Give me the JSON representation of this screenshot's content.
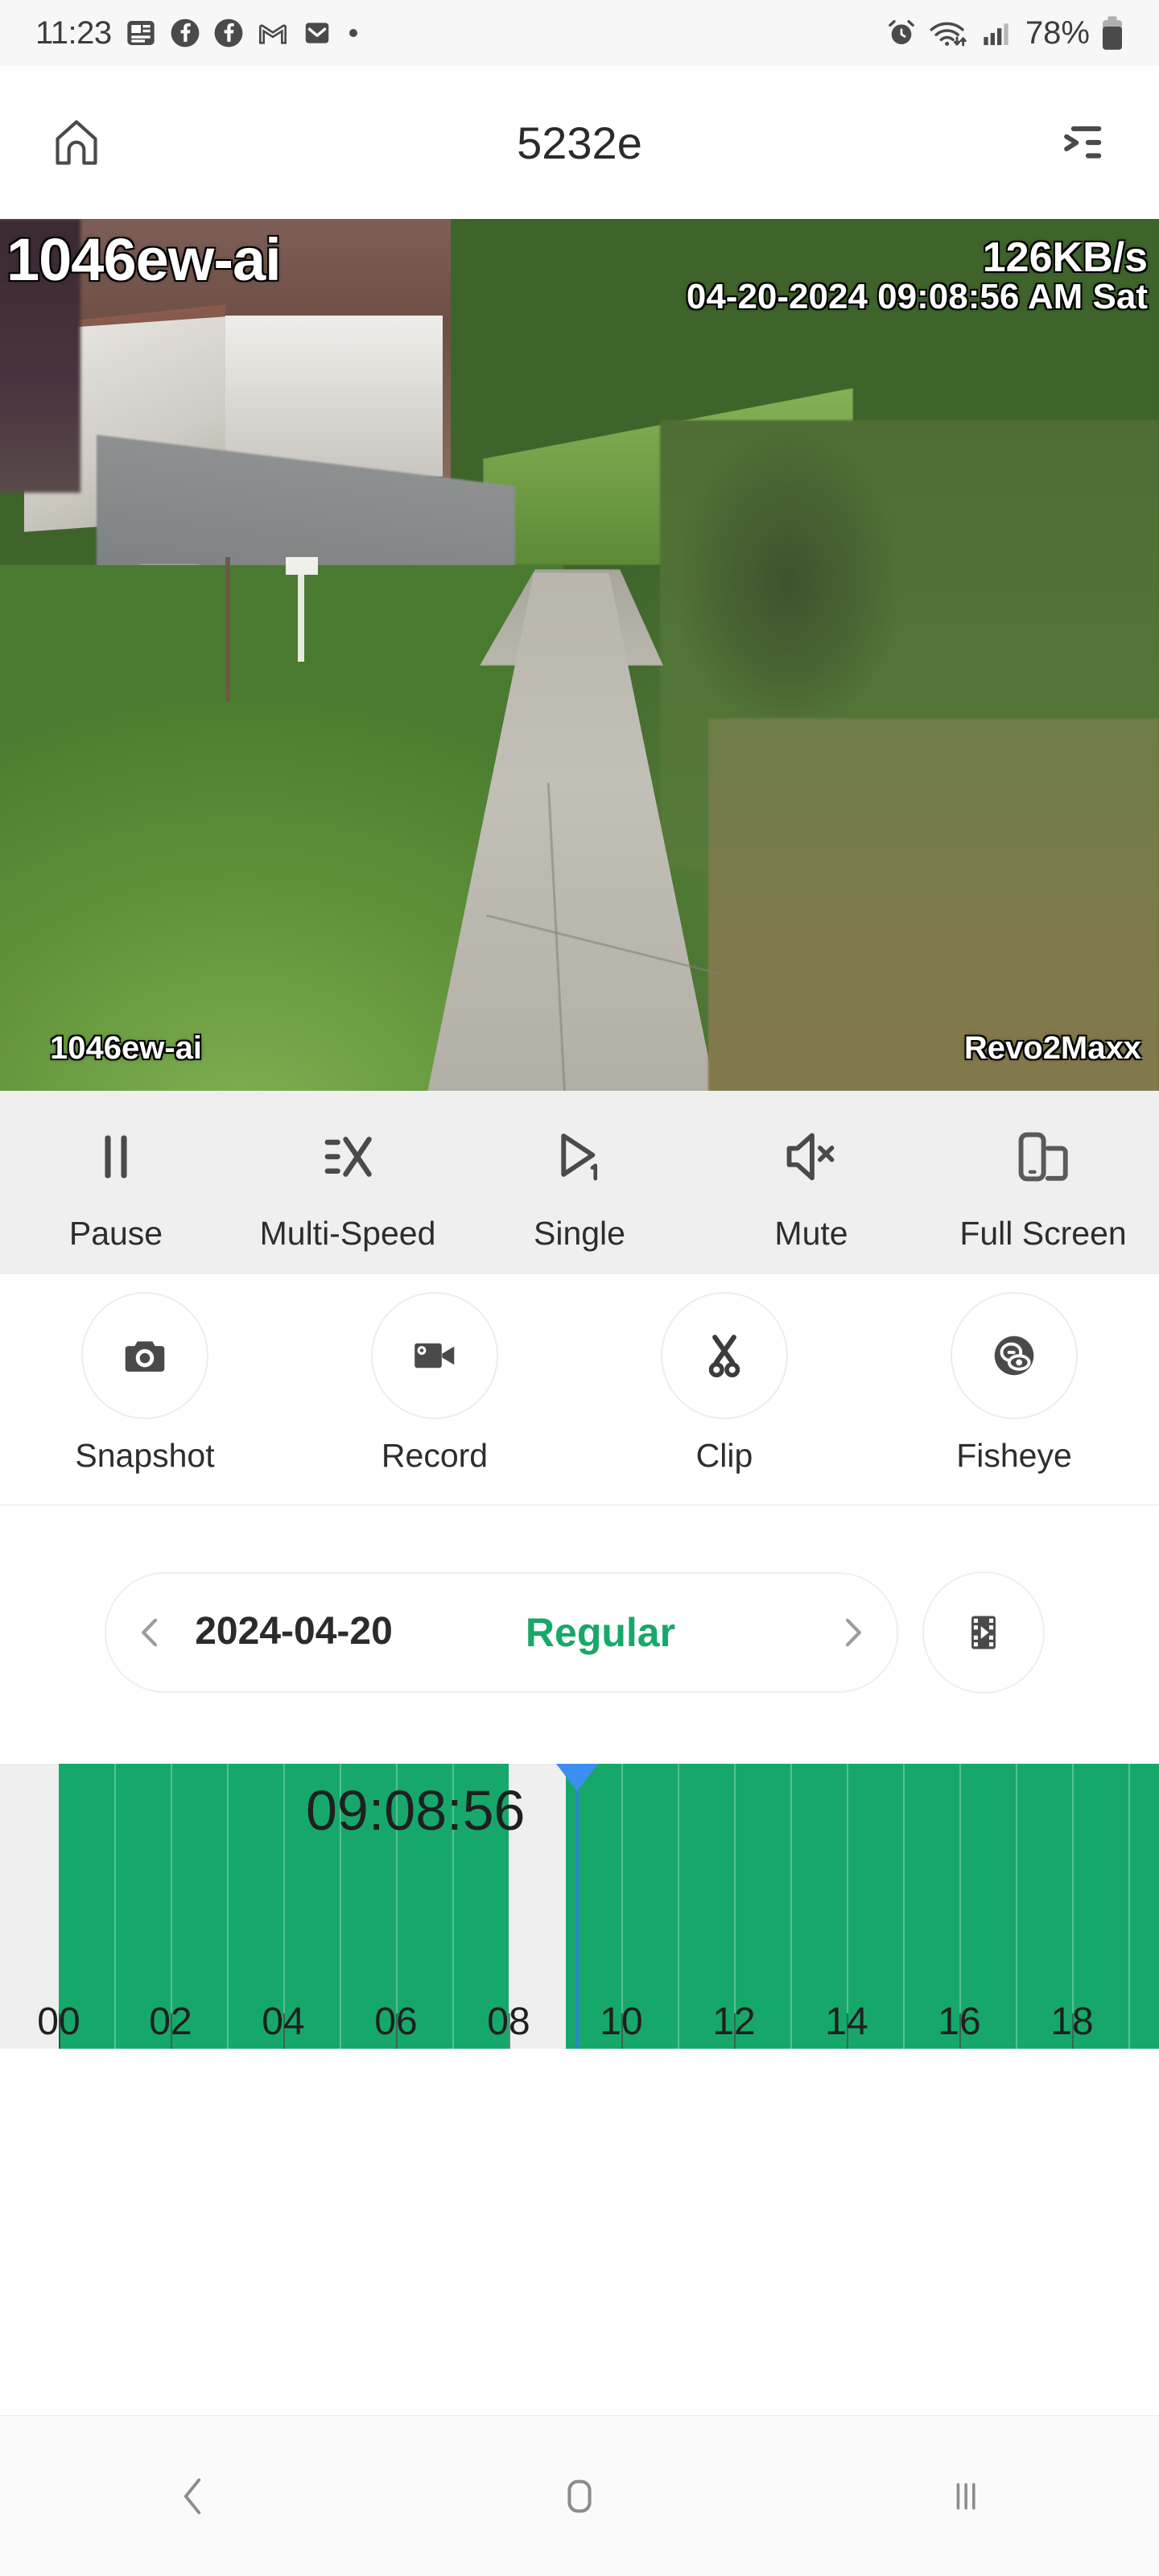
{
  "status_bar": {
    "clock": "11:23",
    "battery_text": "78%",
    "icons": [
      "news-icon",
      "facebook-icon",
      "facebook-icon",
      "gmail-icon",
      "mail-icon",
      "dot-icon"
    ],
    "right_icons": [
      "alarm-icon",
      "wifi-icon",
      "signal-icon",
      "battery-icon"
    ]
  },
  "app_bar": {
    "title": "5232e",
    "home_icon": "home-icon",
    "list_icon": "list-indent-icon"
  },
  "video": {
    "channel_name_top": "1046ew-ai",
    "bitrate": "126KB/s",
    "timestamp": "04-20-2024 09:08:56 AM Sat",
    "channel_name_bottom": "1046ew-ai",
    "brand": "Revo2Maxx"
  },
  "controls_primary": [
    {
      "label": "Pause",
      "icon": "pause-icon"
    },
    {
      "label": "Multi-Speed",
      "icon": "multi-speed-icon"
    },
    {
      "label": "Single",
      "icon": "single-play-icon"
    },
    {
      "label": "Mute",
      "icon": "mute-icon"
    },
    {
      "label": "Full Screen",
      "icon": "full-screen-icon"
    }
  ],
  "controls_secondary": [
    {
      "label": "Snapshot",
      "icon": "camera-icon"
    },
    {
      "label": "Record",
      "icon": "video-camera-icon"
    },
    {
      "label": "Clip",
      "icon": "scissors-icon"
    },
    {
      "label": "Fisheye",
      "icon": "fisheye-icon"
    }
  ],
  "date_nav": {
    "prev_icon": "chevron-left-icon",
    "date": "2024-04-20",
    "mode": "Regular",
    "next_icon": "chevron-right-icon",
    "film_icon": "film-clip-icon",
    "accent_color": "#17a86a"
  },
  "timeline": {
    "current_time": "09:08:56",
    "hour_labels": [
      "00",
      "02",
      "04",
      "06",
      "08",
      "10",
      "12",
      "14",
      "16",
      "18"
    ],
    "segment_color": "#16a86a",
    "track_color": "#efefef",
    "playhead_color": "#3d8ef0"
  },
  "nav_bar": {
    "back_icon": "chevron-back-icon",
    "home_icon": "home-square-icon",
    "recents_icon": "recents-bars-icon"
  }
}
